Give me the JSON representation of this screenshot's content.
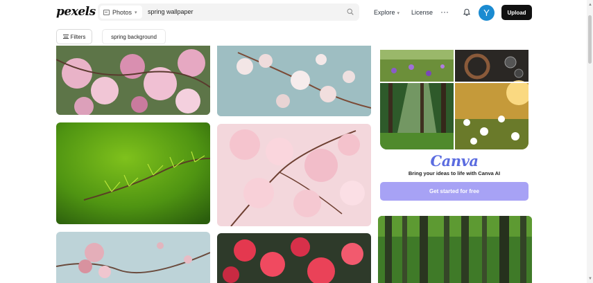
{
  "header": {
    "logo": "pexels",
    "search": {
      "type_label": "Photos",
      "query": "spring wallpaper"
    },
    "nav": {
      "explore": "Explore",
      "license": "License",
      "more": "···"
    },
    "avatar_initial": "Y",
    "upload_label": "Upload"
  },
  "filters": {
    "filters_label": "Filters",
    "chip_label": "spring background"
  },
  "ad": {
    "brand": "Canva",
    "tagline": "Bring your ideas to life with Canva AI",
    "cta": "Get started for free"
  },
  "colors": {
    "avatar": "#1b8bd1",
    "upload_bg": "#111111",
    "canva_brand": "#5b6ce0",
    "cta_bg": "#a7a2f5"
  },
  "icons": [
    "image-icon",
    "chevron-down-icon",
    "search-icon",
    "bell-icon",
    "filter-icon"
  ]
}
